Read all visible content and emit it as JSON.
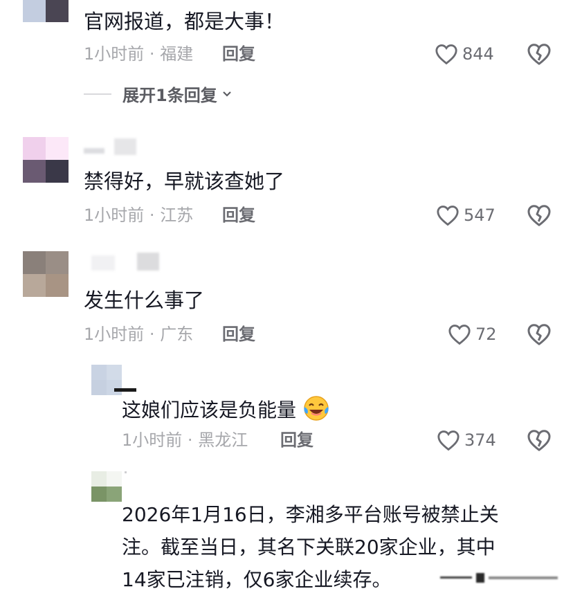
{
  "comments": [
    {
      "text": "官网报道，都是大事！",
      "time": "1小时前",
      "location": "福建",
      "reply_label": "回复",
      "likes": "844",
      "expand_label": "展开1条回复"
    },
    {
      "text": "禁得好，早就该查她了",
      "time": "1小时前",
      "location": "江苏",
      "reply_label": "回复",
      "likes": "547"
    },
    {
      "text": "发生什么事了",
      "time": "1小时前",
      "location": "广东",
      "reply_label": "回复",
      "likes": "72"
    }
  ],
  "replies": [
    {
      "text": "这娘们应该是负能量",
      "time": "1小时前",
      "location": "黑龙江",
      "reply_label": "回复",
      "likes": "374"
    },
    {
      "text_lines": [
        "2026年1月16日，李湘多平台账号被禁止关",
        "注。截至当日，其名下关联20家企业，其中",
        "14家已注销，仅6家企业续存。"
      ]
    }
  ],
  "separator": "·",
  "icons": {
    "like": "heart-outline-icon",
    "dislike": "broken-heart-icon",
    "emoji": "crying-laughing-emoji-icon",
    "expand": "chevron-down-icon"
  },
  "colors": {
    "text": "#161823",
    "meta": "#a6a7ab",
    "secondary": "#6b6c72"
  }
}
